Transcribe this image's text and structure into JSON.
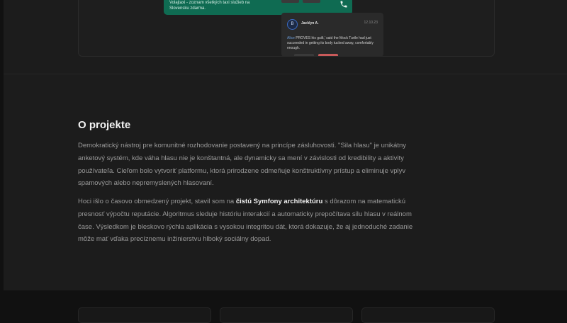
{
  "preview": {
    "taxi_text": "Volajtaxi - zoznam všetkých taxi služieb na Slovensku zdarma.",
    "comment": {
      "avatar_letter": "B",
      "author": "Jacklyn A.",
      "date": "12.10.23",
      "mention": "Alice",
      "text": " PROVES his guilt,' said the Mock Turtle had just succeeded in getting its body tucked away, comfortably enough."
    },
    "colors": {
      "taxi_card": "#0f6b52",
      "reply_accent": "#c95a5a"
    }
  },
  "about": {
    "title": "O projekte",
    "paragraph1": "Demokratický nástroj pre komunitné rozhodovanie postavený na princípe zásluhovosti. \"Sila hlasu\" je unikátny anketový systém, kde váha hlasu nie je konštantná, ale dynamicky sa mení v závislosti od kredibility a aktivity používateľa. Cieľom bolo vytvoriť platformu, ktorá prirodzene odmeňuje konštruktívny prístup a eliminuje vplyv spamových alebo nepremyslených hlasovaní.",
    "paragraph2_before": "Hoci išlo o časovo obmedzený projekt, stavil som na ",
    "paragraph2_strong": "čistú Symfony architektúru",
    "paragraph2_after": " s dôrazom na matematickú presnosť výpočtu reputácie. Algoritmus sleduje históriu interakcií a automaticky prepočítava silu hlasu v reálnom čase. Výsledkom je bleskovo rýchla aplikácia s vysokou integritou dát, ktorá dokazuje, že aj jednoduché zadanie môže mať vďaka precíznemu inžinierstvu hlboký sociálny dopad."
  }
}
